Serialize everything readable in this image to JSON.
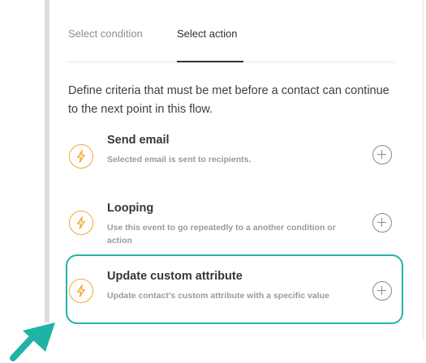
{
  "tabs": [
    {
      "label": "Select condition",
      "active": false
    },
    {
      "label": "Select action",
      "active": true
    }
  ],
  "description": "Define criteria that must be met before a contact can continue to the next point in this flow.",
  "actions": [
    {
      "title": "Send email",
      "description": "Selected email is sent to recipients.",
      "icon": "lightning-icon",
      "add_icon": "plus-circle-icon"
    },
    {
      "title": "Looping",
      "description": "Use this event to go repeatedly to a another condition or action",
      "icon": "lightning-icon",
      "add_icon": "plus-circle-icon"
    },
    {
      "title": "Update custom attribute",
      "description": "Update contact's custom attribute with a specific value",
      "icon": "lightning-icon",
      "add_icon": "plus-circle-icon",
      "highlighted": true
    }
  ],
  "colors": {
    "accent_icon": "#f5a638",
    "highlight": "#22b5a4",
    "pointer_arrow": "#1fb3a5",
    "panel_border": "#dcdcdc"
  }
}
